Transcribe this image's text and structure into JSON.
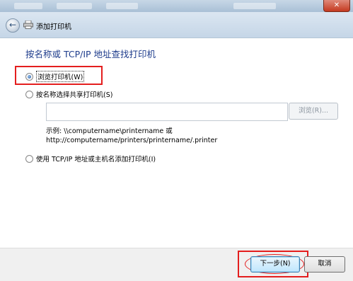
{
  "header": {
    "title": "添加打印机"
  },
  "main": {
    "title": "按名称或 TCP/IP 地址查找打印机",
    "options": [
      {
        "label": "浏览打印机(W)",
        "selected": true
      },
      {
        "label": "按名称选择共享打印机(S)",
        "selected": false
      },
      {
        "label": "使用 TCP/IP 地址或主机名添加打印机(I)",
        "selected": false
      }
    ],
    "share_input_value": "",
    "browse_label": "浏览(R)...",
    "example_line1": "示例: \\\\computername\\printername 或",
    "example_line2": "http://computername/printers/printername/.printer"
  },
  "footer": {
    "next_label": "下一步(N)",
    "cancel_label": "取消"
  },
  "colors": {
    "annotation": "#e41e1e",
    "title_blue": "#1e3c8c"
  },
  "icons": [
    "back-arrow-icon",
    "printer-icon",
    "close-icon"
  ]
}
